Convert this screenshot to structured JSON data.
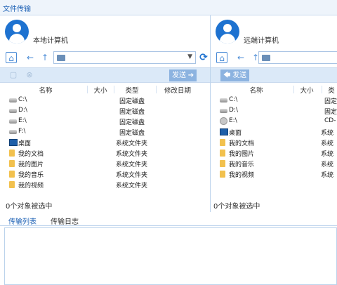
{
  "window": {
    "title": "文件传输"
  },
  "local": {
    "name": "本地计算机",
    "send_label": "发送",
    "columns": [
      "名称",
      "大小",
      "类型",
      "修改日期"
    ],
    "items": [
      {
        "name": "C:\\",
        "type": "固定磁盘",
        "icon": "drive-icon"
      },
      {
        "name": "D:\\",
        "type": "固定磁盘",
        "icon": "drive-icon"
      },
      {
        "name": "E:\\",
        "type": "固定磁盘",
        "icon": "drive-icon"
      },
      {
        "name": "F:\\",
        "type": "固定磁盘",
        "icon": "drive-icon"
      },
      {
        "name": "桌面",
        "type": "系统文件夹",
        "icon": "desktop-icon"
      },
      {
        "name": "我的文档",
        "type": "系统文件夹",
        "icon": "folder-icon"
      },
      {
        "name": "我的图片",
        "type": "系统文件夹",
        "icon": "folder-icon"
      },
      {
        "name": "我的音乐",
        "type": "系统文件夹",
        "icon": "folder-icon"
      },
      {
        "name": "我的视频",
        "type": "系统文件夹",
        "icon": "folder-icon"
      }
    ],
    "status": "0个对象被选中"
  },
  "remote": {
    "name": "远端计算机",
    "send_label": "发送",
    "columns": [
      "名称",
      "大小",
      "类"
    ],
    "items": [
      {
        "name": "C:\\",
        "type": "固定",
        "icon": "drive-icon"
      },
      {
        "name": "D:\\",
        "type": "固定",
        "icon": "drive-icon"
      },
      {
        "name": "E:\\",
        "type": "CD-",
        "icon": "cd-drive-icon"
      },
      {
        "name": "桌面",
        "type": "系统",
        "icon": "desktop-icon"
      },
      {
        "name": "我的文档",
        "type": "系统",
        "icon": "folder-icon"
      },
      {
        "name": "我的图片",
        "type": "系统",
        "icon": "folder-icon"
      },
      {
        "name": "我的音乐",
        "type": "系统",
        "icon": "folder-icon"
      },
      {
        "name": "我的视频",
        "type": "系统",
        "icon": "folder-icon"
      }
    ],
    "status": "0个对象被选中"
  },
  "tabs": {
    "transfer_list": "传输列表",
    "transfer_log": "传输日志"
  }
}
